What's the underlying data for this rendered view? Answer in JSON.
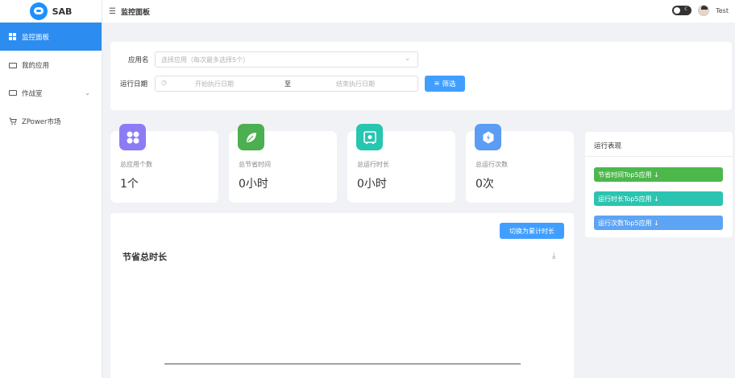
{
  "app": {
    "name": "SAB"
  },
  "sidebar": {
    "items": [
      {
        "label": "监控面板",
        "icon": "grid-icon"
      },
      {
        "label": "我的应用",
        "icon": "briefcase-icon"
      },
      {
        "label": "作战室",
        "icon": "monitor-icon"
      },
      {
        "label": "ZPower市场",
        "icon": "cart-icon"
      }
    ]
  },
  "header": {
    "title": "监控面板",
    "user": "Test"
  },
  "filter": {
    "app_label": "应用名",
    "app_placeholder": "选择应用（每次最多选择5个）",
    "date_label": "运行日期",
    "start_placeholder": "开始执行日期",
    "to": "至",
    "end_placeholder": "结束执行日期",
    "button": "筛选"
  },
  "stats": [
    {
      "label": "总应用个数",
      "value": "1个",
      "icon": "apps-icon",
      "color": "#8b7cf6"
    },
    {
      "label": "总节省时间",
      "value": "0小时",
      "icon": "leaf-icon",
      "color": "#4caf50"
    },
    {
      "label": "总运行时长",
      "value": "0小时",
      "icon": "safe-icon",
      "color": "#26c6b0"
    },
    {
      "label": "总运行次数",
      "value": "0次",
      "icon": "hexagon-icon",
      "color": "#5b9cf5"
    }
  ],
  "chart": {
    "switch_button": "切换为累计时长",
    "title": "节省总时长"
  },
  "performance": {
    "title": "运行表现",
    "buttons": [
      {
        "label": "节省时间Top5应用 ↓",
        "color": "#4cb84c"
      },
      {
        "label": "运行时长Top5应用 ↓",
        "color": "#2bc4b0"
      },
      {
        "label": "运行次数Top5应用 ↓",
        "color": "#5ea4f5"
      }
    ]
  }
}
